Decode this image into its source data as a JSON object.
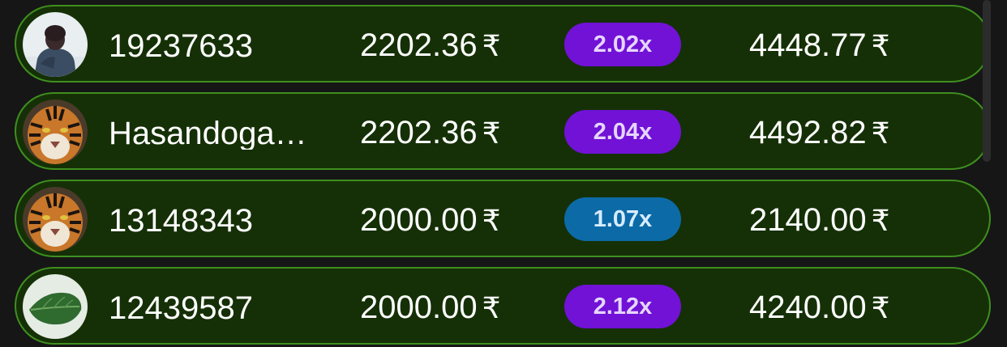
{
  "currency_symbol": "₹",
  "colors": {
    "row_background": "#153006",
    "row_border": "#3f8f1f",
    "multiplier_purple": "#7112d6",
    "multiplier_blue": "#0c6aa7"
  },
  "bets": [
    {
      "username": "19237633",
      "avatar_icon": "person-photo-avatar",
      "bet": "2202.36",
      "multiplier": "2.02x",
      "multiplier_color": "purple",
      "win": "4448.77"
    },
    {
      "username": "Hasandoga…",
      "avatar_icon": "tiger-avatar",
      "bet": "2202.36",
      "multiplier": "2.04x",
      "multiplier_color": "purple",
      "win": "4492.82"
    },
    {
      "username": "13148343",
      "avatar_icon": "tiger-avatar",
      "bet": "2000.00",
      "multiplier": "1.07x",
      "multiplier_color": "blue",
      "win": "2140.00"
    },
    {
      "username": "12439587",
      "avatar_icon": "leaf-avatar",
      "bet": "2000.00",
      "multiplier": "2.12x",
      "multiplier_color": "purple",
      "win": "4240.00"
    }
  ]
}
